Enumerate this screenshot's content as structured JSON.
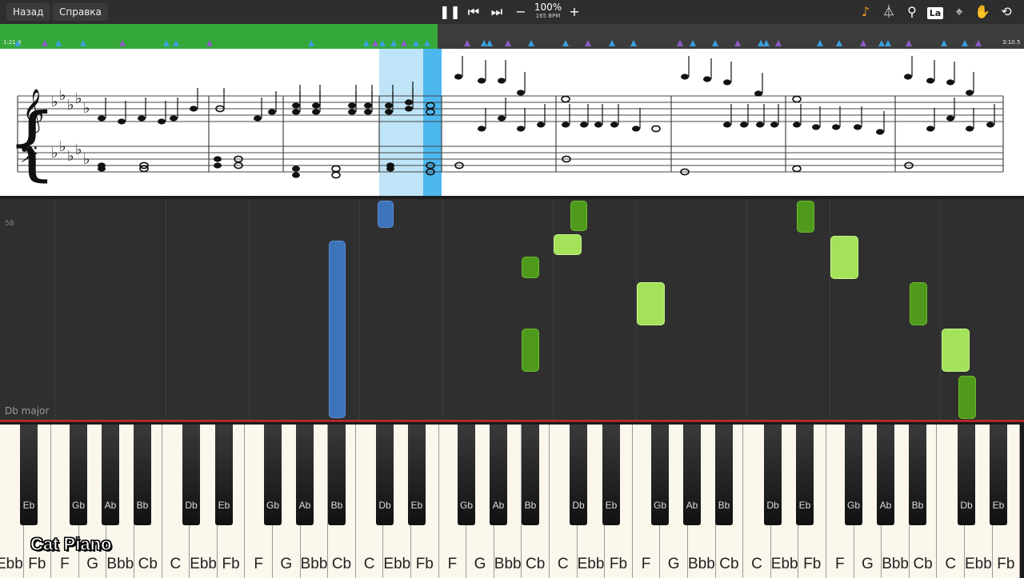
{
  "toolbar": {
    "back_label": "Назад",
    "help_label": "Справка",
    "tempo_percent": "100%",
    "tempo_bpm": "165 BPM",
    "icons": [
      "pause-icon",
      "skip-back-icon",
      "skip-forward-icon",
      "minus-icon",
      "plus-icon",
      "note-icon",
      "metronome-icon",
      "magnifier-icon",
      "la-icon",
      "location-icon",
      "hand-icon",
      "loop-icon"
    ],
    "la_label": "La"
  },
  "timeline": {
    "time_start": "1:21.4",
    "time_end": "3:10.5",
    "progress": 0.427
  },
  "score": {
    "key_signature": "Db major"
  },
  "pianoroll": {
    "row_number": "58"
  },
  "keyboard": {
    "white_keys": [
      "Ebb",
      "Fb",
      "F",
      "G",
      "Bbb",
      "Cb",
      "C",
      "Ebb",
      "Fb",
      "F",
      "G",
      "Bbb",
      "Cb",
      "C",
      "Ebb",
      "Fb",
      "F",
      "G",
      "Bbb",
      "Cb",
      "C",
      "Ebb",
      "Fb",
      "F",
      "G",
      "Bbb",
      "Cb",
      "C",
      "Ebb",
      "Fb",
      "F",
      "G",
      "Bbb",
      "Cb",
      "C",
      "Ebb",
      "Fb"
    ],
    "black_keys": [
      "Eb",
      "Gb",
      "Ab",
      "Bb",
      "Db",
      "Eb",
      "Gb",
      "Ab",
      "Bb",
      "Db",
      "Eb",
      "Gb",
      "Ab",
      "Bb",
      "Db",
      "Eb",
      "Gb",
      "Ab",
      "Bb",
      "Db",
      "Eb",
      "Gb",
      "Ab",
      "Bb",
      "Db",
      "Eb",
      "Gb",
      "Ab",
      "Bb",
      "Db",
      "Eb"
    ]
  },
  "watermark": "Cat Piano",
  "colors": {
    "progress_green": "#35a83a",
    "note_blue": "#3d73b8",
    "note_dark_green": "#4f9a1c",
    "note_light_green": "#a4e25a",
    "cursor_blue": "#4db8f0"
  }
}
